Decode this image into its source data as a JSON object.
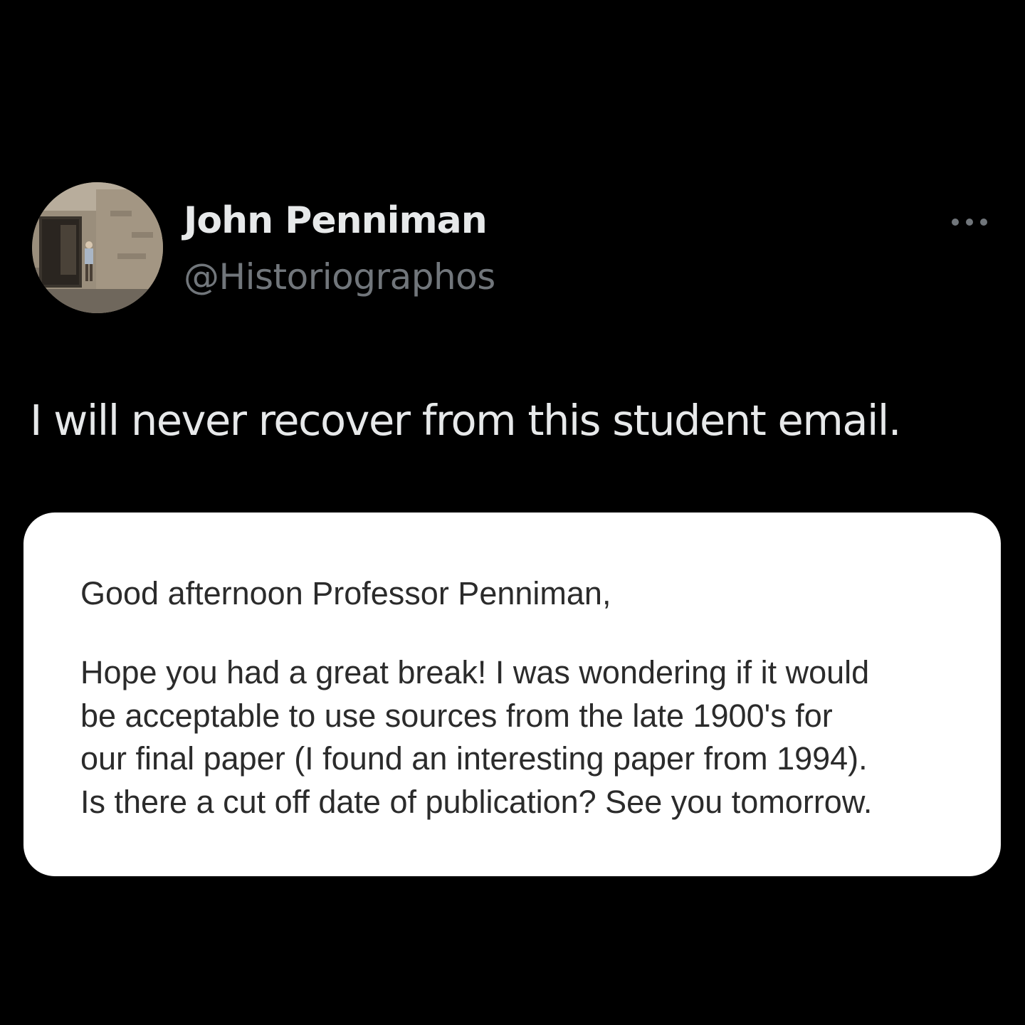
{
  "author": {
    "display_name": "John Penniman",
    "handle": "@Historiographos",
    "avatar_icon": "profile-photo"
  },
  "actions": {
    "more_icon": "more-horizontal-icon"
  },
  "tweet": {
    "text": "I will never recover from this student email."
  },
  "email": {
    "greeting": "Good afternoon Professor Penniman,",
    "body_lines": [
      "Hope you had a great break! I was wondering if it would",
      "be acceptable to use sources from the late 1900's for",
      "our final paper (I found an interesting paper from 1994).",
      "Is there a cut off date of publication? See you tomorrow."
    ]
  },
  "colors": {
    "background": "#000000",
    "primary_text": "#e7e9ea",
    "secondary_text": "#71767b",
    "card_background": "#ffffff",
    "card_text": "#2b2b2b"
  }
}
